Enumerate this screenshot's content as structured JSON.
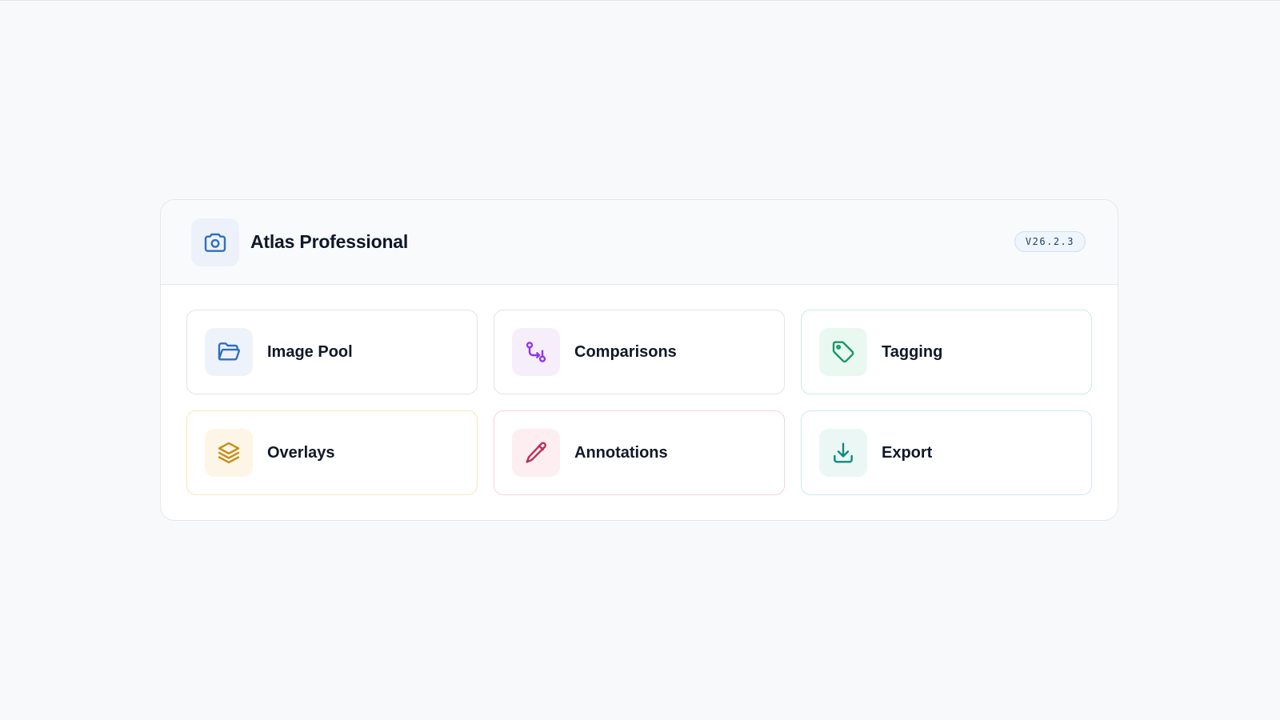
{
  "app": {
    "title": "Atlas Professional",
    "version": "V26.2.3",
    "icon": "camera-icon"
  },
  "tiles": [
    {
      "label": "Image Pool",
      "icon": "folder-open-icon",
      "color": "#2f6fbf"
    },
    {
      "label": "Comparisons",
      "icon": "git-compare-icon",
      "color": "#9333ea"
    },
    {
      "label": "Tagging",
      "icon": "tag-icon",
      "color": "#16966b"
    },
    {
      "label": "Overlays",
      "icon": "layers-icon",
      "color": "#c98a12"
    },
    {
      "label": "Annotations",
      "icon": "pencil-icon",
      "color": "#be2d55"
    },
    {
      "label": "Export",
      "icon": "download-icon",
      "color": "#0f8a7c"
    }
  ],
  "colors": {
    "page_background": "#f8f9fb",
    "panel_background": "#ffffff",
    "accent": "#2f6fbf"
  }
}
